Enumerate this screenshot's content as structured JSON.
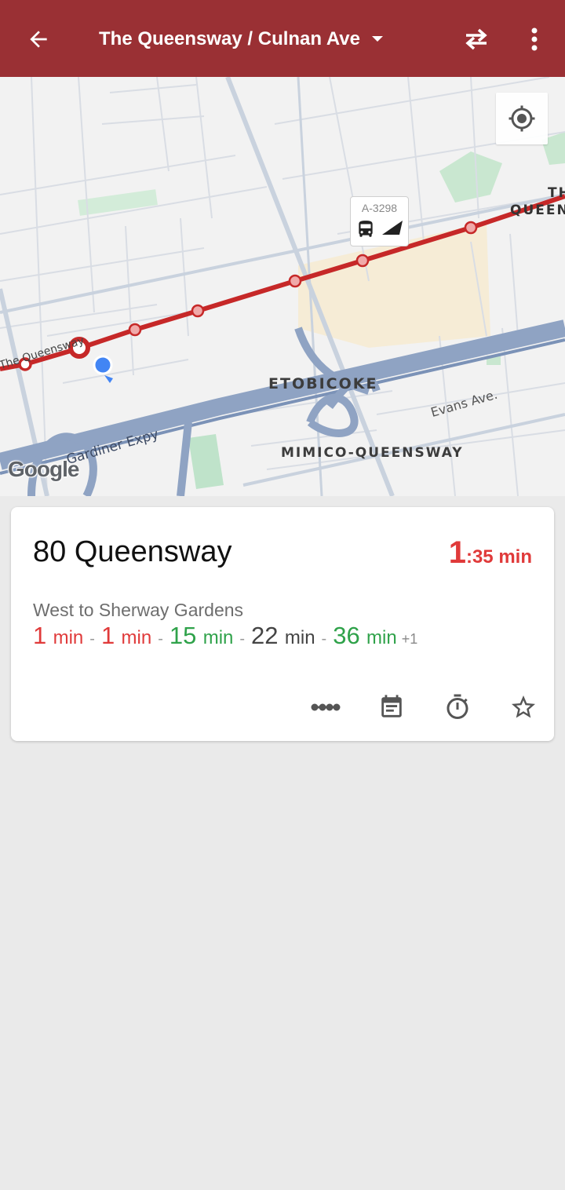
{
  "appbar": {
    "title": "The Queensway / Culnan Ave",
    "background_color": "#9a3034",
    "icons": [
      "arrow-back-icon",
      "dropdown-caret-icon",
      "swap-direction-icon",
      "more-vert-icon"
    ]
  },
  "map": {
    "labels": {
      "queensway": "The Queensway",
      "etobicoke": "ETOBICOKE",
      "mimico": "MIMICO-QUEENSWAY",
      "evans": "Evans Ave.",
      "gardiner": "Gardiner Expy",
      "queen": "QUEEN",
      "th": "TH"
    },
    "attribution": "Google",
    "vehicle": {
      "id": "A-3298"
    },
    "route_color": "#c62828",
    "icons": [
      "my-location-icon",
      "bus-icon",
      "heading-arrow-icon"
    ]
  },
  "card": {
    "route_name": "80 Queensway",
    "eta": {
      "major": "1",
      "minor": ":35 min"
    },
    "direction": "West to Sherway Gardens",
    "predictions": [
      {
        "value": "1",
        "unit": "min",
        "status": "realtime-soon"
      },
      {
        "value": "1",
        "unit": "min",
        "status": "realtime-soon"
      },
      {
        "value": "15",
        "unit": "min",
        "status": "realtime"
      },
      {
        "value": "22",
        "unit": "min",
        "status": "scheduled"
      },
      {
        "value": "36",
        "unit": "min",
        "status": "realtime"
      }
    ],
    "more_count": "+1",
    "colors": {
      "soon": "#e03a3a",
      "realtime": "#2fa24a",
      "scheduled": "#444444"
    },
    "actions": [
      "route-stops-icon",
      "schedule-icon",
      "timer-icon",
      "favorite-star-icon"
    ]
  }
}
